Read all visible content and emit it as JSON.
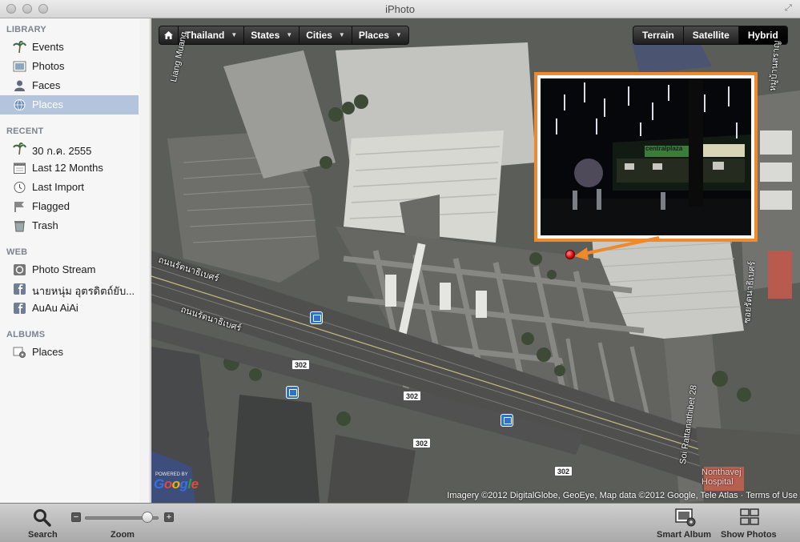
{
  "window": {
    "title": "iPhoto"
  },
  "sidebar": {
    "sections": [
      {
        "header": "LIBRARY",
        "items": [
          {
            "label": "Events",
            "icon": "palm-tree-icon"
          },
          {
            "label": "Photos",
            "icon": "photo-icon"
          },
          {
            "label": "Faces",
            "icon": "person-icon"
          },
          {
            "label": "Places",
            "icon": "globe-icon",
            "selected": true
          }
        ]
      },
      {
        "header": "RECENT",
        "items": [
          {
            "label": "30 ก.ค. 2555",
            "icon": "palm-tree-icon"
          },
          {
            "label": "Last 12 Months",
            "icon": "calendar-icon"
          },
          {
            "label": "Last Import",
            "icon": "clock-icon"
          },
          {
            "label": "Flagged",
            "icon": "flag-icon"
          },
          {
            "label": "Trash",
            "icon": "trash-icon"
          }
        ]
      },
      {
        "header": "WEB",
        "items": [
          {
            "label": "Photo Stream",
            "icon": "photo-stream-icon"
          },
          {
            "label": "นายหนุ่ม อุตรดิตถ์ยับ...",
            "icon": "facebook-icon"
          },
          {
            "label": "AuAu AiAi",
            "icon": "facebook-icon"
          }
        ]
      },
      {
        "header": "ALBUMS",
        "items": [
          {
            "label": "Places",
            "icon": "smart-album-gear-icon"
          }
        ]
      }
    ]
  },
  "map": {
    "nav": {
      "thailand": "Thailand",
      "states": "States",
      "cities": "Cities",
      "places": "Places"
    },
    "modes": {
      "terrain": "Terrain",
      "satellite": "Satellite",
      "hybrid": "Hybrid",
      "active": "Hybrid"
    },
    "attribution": "Imagery ©2012 DigitalGlobe, GeoEye, Map data ©2012 Google, Tele Atlas · Terms of Use",
    "logo": {
      "powered": "POWERED BY",
      "text": "Google"
    },
    "labels": {
      "road1": "ถนนรัตนาธิเบศร์",
      "road2": "ถนนรัตนาธิเบศร์",
      "liang_muang": "Liang Muang",
      "soi_rattanathibet": "Soi Rattanathibet 28",
      "right_road": "ซอยรัตนาธิเบศร์",
      "top_right_road": "หมู่บ้านสราญ",
      "hospital": "Nonthavej Hospital",
      "shield": "302"
    },
    "photo_sign": "centralplaza"
  },
  "bottom": {
    "search": "Search",
    "zoom": "Zoom",
    "zoom_minus": "−",
    "zoom_plus": "+",
    "zoom_level": 0.85,
    "smart_album": "Smart Album",
    "show_photos": "Show Photos"
  }
}
